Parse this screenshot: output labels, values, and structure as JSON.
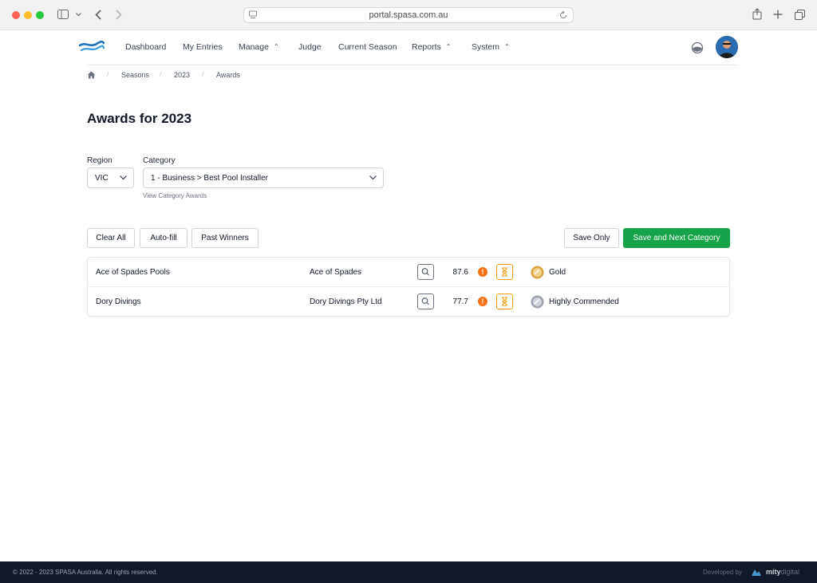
{
  "browser": {
    "url": "portal.spasa.com.au"
  },
  "nav": {
    "items": [
      {
        "label": "Dashboard"
      },
      {
        "label": "My Entries"
      },
      {
        "label": "Manage"
      },
      {
        "label": "Judge"
      },
      {
        "label": "Current Season"
      },
      {
        "label": "Reports"
      },
      {
        "label": "System"
      }
    ],
    "caret": "⌃"
  },
  "breadcrumb": {
    "sep": "/",
    "items": [
      "Seasons",
      "2023",
      "Awards"
    ]
  },
  "page": {
    "title": "Awards for 2023"
  },
  "filters": {
    "region_label": "Region",
    "region_value": "VIC",
    "category_label": "Category",
    "category_value": "1 - Business > Best Pool Installer",
    "view_link": "View Category Awards"
  },
  "actions": {
    "clear_all": "Clear All",
    "auto_fill": "Auto-fill",
    "past_winners": "Past Winners",
    "save_only": "Save Only",
    "save_next": "Save and Next Category"
  },
  "entries": [
    {
      "name": "Ace of Spades Pools",
      "company": "Ace of Spades",
      "score": "87.6",
      "warn": "!",
      "award": "Gold",
      "medal_color": "#d9a441"
    },
    {
      "name": "Dory Divings",
      "company": "Dory Divings Pty Ltd",
      "score": "77.7",
      "warn": "!",
      "award": "Highly Commended",
      "medal_color": "#9ca3af"
    }
  ],
  "footer": {
    "copyright": "© 2022 - 2023 SPASA Australia. All rights reserved.",
    "developed_by": "Developed by",
    "brand_main": "mity",
    "brand_sub": "digital"
  },
  "colors": {
    "primary_green": "#16a34a",
    "warning_orange": "#f97316",
    "hourglass_amber": "#f59e0b",
    "footer_bg": "#111827"
  }
}
